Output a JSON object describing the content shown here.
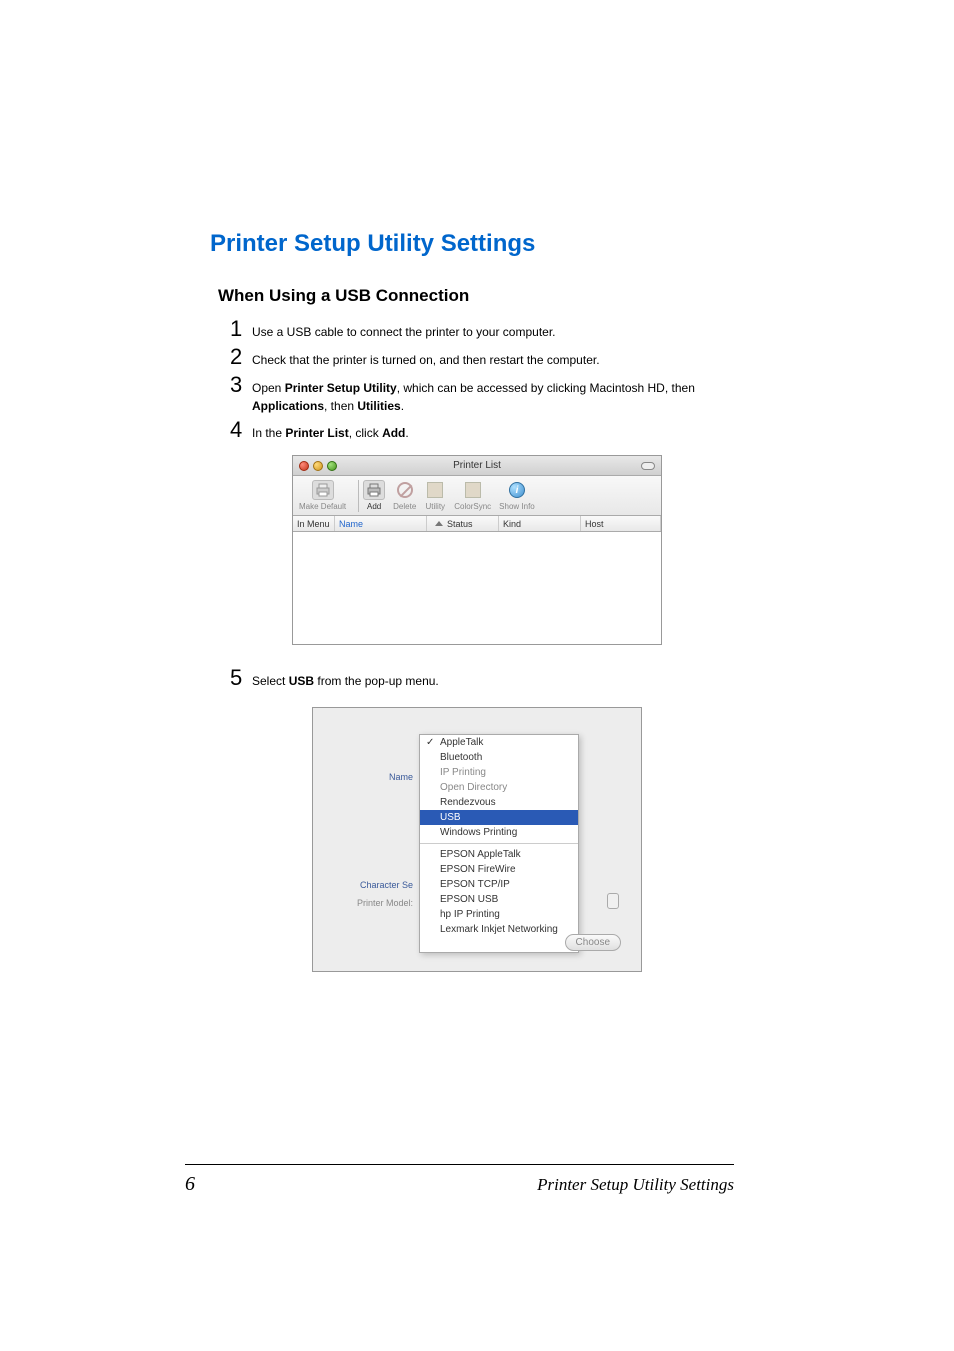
{
  "heading": "Printer Setup Utility Settings",
  "subheading": "When Using a USB Connection",
  "steps": {
    "s1": {
      "num": "1",
      "text": "Use a USB cable to connect the printer to your computer."
    },
    "s2": {
      "num": "2",
      "text": "Check that the printer is turned on, and then restart the computer."
    },
    "s3": {
      "num": "3",
      "pre": "Open ",
      "b1": "Printer Setup Utility",
      "mid1": ", which can be accessed by clicking Macintosh HD, then ",
      "b2": "Applications",
      "mid2": ", then ",
      "b3": "Utilities",
      "post": "."
    },
    "s4": {
      "num": "4",
      "pre": "In the ",
      "b1": "Printer List",
      "mid": ", click ",
      "b2": "Add",
      "post": "."
    },
    "s5": {
      "num": "5",
      "pre": "Select ",
      "b1": "USB",
      "post": " from the pop-up menu."
    }
  },
  "figure1": {
    "title": "Printer List",
    "toolbar": {
      "make_default": "Make Default",
      "add": "Add",
      "delete": "Delete",
      "utility": "Utility",
      "colorsync": "ColorSync",
      "show_info": "Show Info"
    },
    "columns": {
      "in_menu": "In Menu",
      "name": "Name",
      "status": "Status",
      "kind": "Kind",
      "host": "Host"
    }
  },
  "figure2": {
    "labels": {
      "name": "Name",
      "character_set": "Character Se",
      "printer_model": "Printer Model:"
    },
    "menu": {
      "appletalk": "AppleTalk",
      "bluetooth": "Bluetooth",
      "ip_printing": "IP Printing",
      "open_directory": "Open Directory",
      "rendezvous": "Rendezvous",
      "usb": "USB",
      "windows_printing": "Windows Printing",
      "epson_appletalk": "EPSON AppleTalk",
      "epson_firewire": "EPSON FireWire",
      "epson_tcpip": "EPSON TCP/IP",
      "epson_usb": "EPSON USB",
      "hp_ip": "hp IP Printing",
      "lexmark": "Lexmark Inkjet Networking"
    },
    "choose": "Choose"
  },
  "footer": {
    "page": "6",
    "text": "Printer Setup Utility Settings"
  }
}
